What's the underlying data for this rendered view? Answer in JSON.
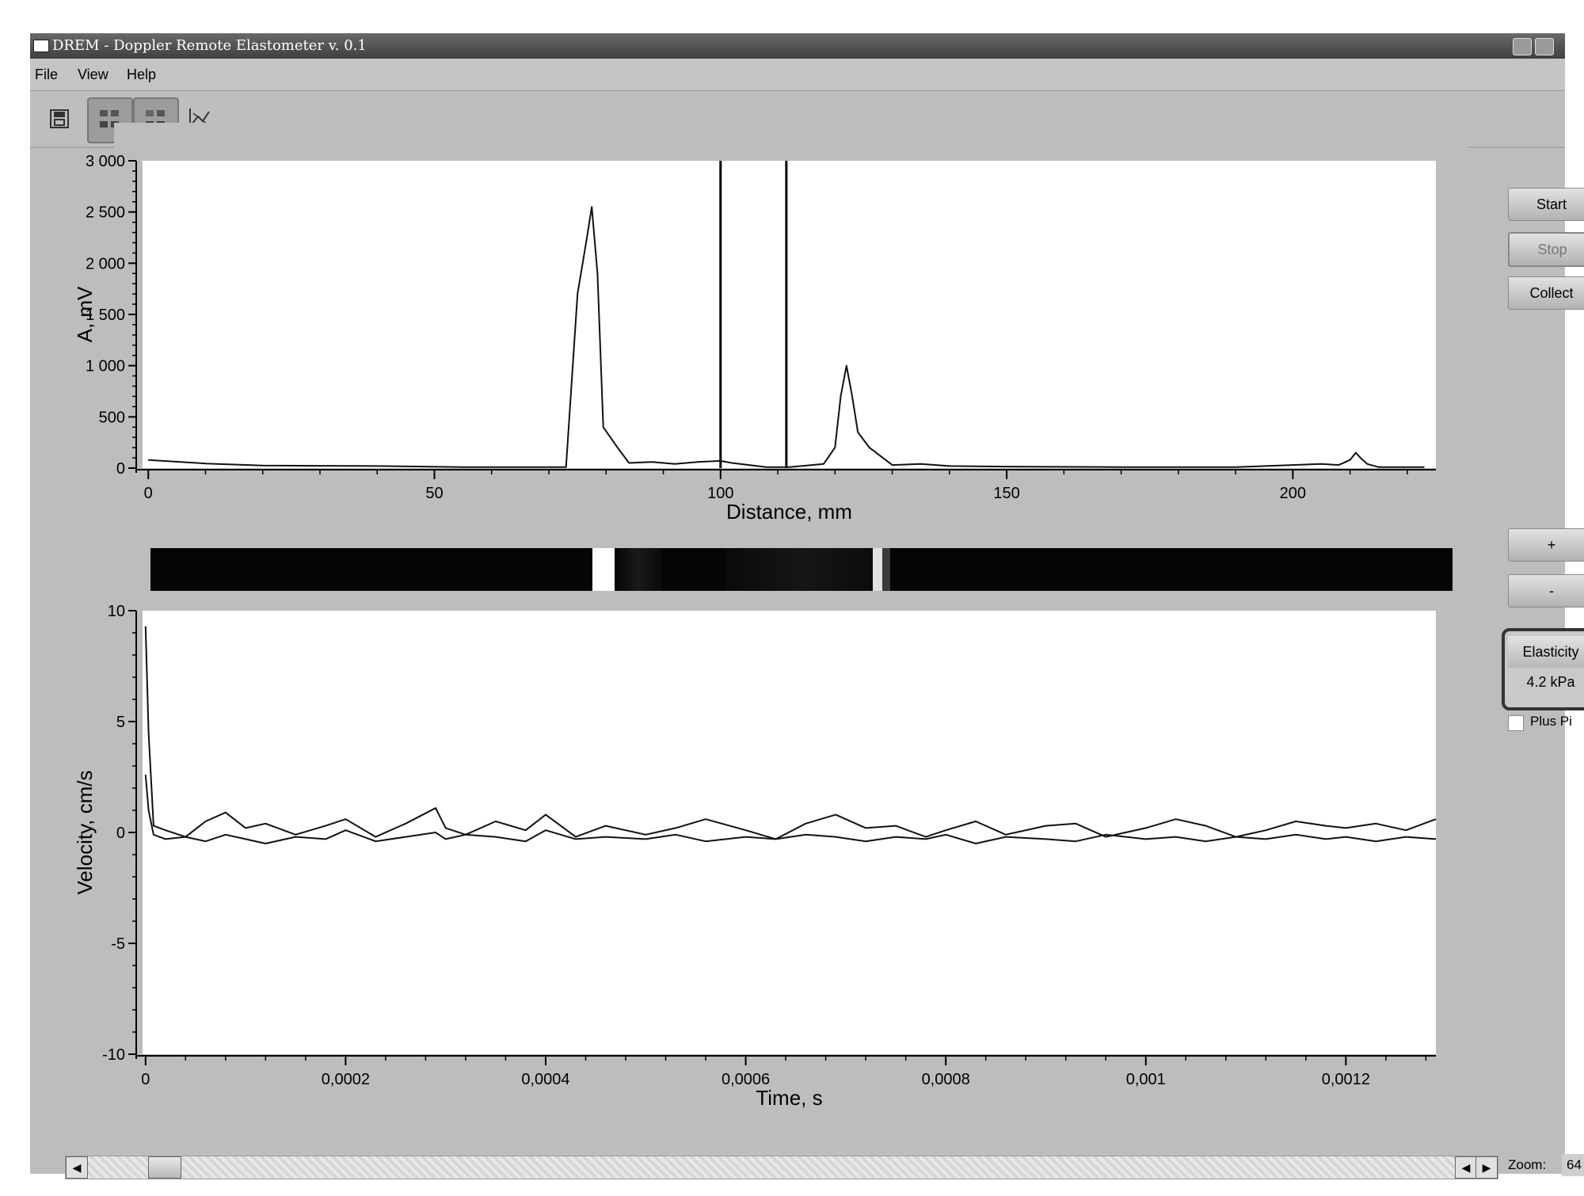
{
  "window": {
    "title": "DREM - Doppler Remote Elastometer v. 0.1"
  },
  "menu": [
    "File",
    "View",
    "Help"
  ],
  "toolbar": {
    "icons": [
      "save-icon",
      "grid-view-icon",
      "grid-view-alt-icon",
      "chart-icon"
    ]
  },
  "controls": {
    "start": "Start",
    "stop": "Stop",
    "collect": "Collect",
    "plus": "+",
    "minus": "-",
    "elasticity_label": "Elasticity",
    "elasticity_value": "4.2 kPa",
    "plus_pi": "Plus Pi",
    "zoom_label": "Zoom:",
    "zoom_value": "64"
  },
  "chart_data": [
    {
      "type": "line",
      "xlabel": "Distance, mm",
      "ylabel": "A, mV",
      "xlim": [
        -1,
        225
      ],
      "ylim": [
        0,
        3000
      ],
      "xticks": [
        0,
        50,
        100,
        150,
        200
      ],
      "xtick_labels": [
        "0",
        "50",
        "100",
        "150",
        "200"
      ],
      "yticks": [
        0,
        500,
        1000,
        1500,
        2000,
        2500,
        3000
      ],
      "ytick_labels": [
        "0",
        "500",
        "1 000",
        "1 500",
        "2 000",
        "2 500",
        "3 000"
      ],
      "markers_x": [
        100,
        111.5
      ],
      "series": [
        {
          "x": [
            0,
            10,
            20,
            40,
            55,
            73,
            75,
            76.5,
            77.5,
            78.5,
            79.5,
            82,
            84,
            88,
            92,
            96,
            100,
            102,
            105,
            108,
            112,
            118,
            120,
            121,
            122,
            123,
            124,
            126,
            130,
            135,
            140,
            150,
            170,
            190,
            205,
            208,
            210,
            211,
            212,
            213,
            215,
            218,
            223
          ],
          "y": [
            80,
            45,
            25,
            20,
            10,
            10,
            1700,
            2200,
            2550,
            1900,
            400,
            200,
            50,
            60,
            40,
            60,
            70,
            50,
            30,
            10,
            10,
            40,
            200,
            700,
            1000,
            700,
            350,
            200,
            30,
            40,
            20,
            15,
            10,
            10,
            40,
            30,
            80,
            150,
            90,
            40,
            10,
            10,
            10
          ]
        }
      ]
    },
    {
      "type": "line",
      "xlabel": "Time, s",
      "ylabel": "Velocity, cm/s",
      "xlim": [
        -3e-06,
        0.00129
      ],
      "ylim": [
        -10,
        10
      ],
      "xticks": [
        0,
        0.0002,
        0.0004,
        0.0006,
        0.0008,
        0.001,
        0.0012
      ],
      "xtick_labels": [
        "0",
        "0,0002",
        "0,0004",
        "0,0006",
        "0,0008",
        "0,001",
        "0,0012"
      ],
      "yticks": [
        -10,
        -5,
        0,
        5,
        10
      ],
      "ytick_labels": [
        "-10",
        "-5",
        "0",
        "5",
        "10"
      ],
      "series": [
        {
          "x": [
            0,
            3e-06,
            8e-06,
            2e-05,
            4e-05,
            6e-05,
            8e-05,
            0.0001,
            0.00012,
            0.00015,
            0.00018,
            0.0002,
            0.00023,
            0.00026,
            0.00029,
            0.0003,
            0.00032,
            0.00035,
            0.00038,
            0.0004,
            0.00043,
            0.00046,
            0.0005,
            0.00053,
            0.00056,
            0.0006,
            0.00063,
            0.00066,
            0.00069,
            0.00072,
            0.00075,
            0.00078,
            0.0008,
            0.00083,
            0.00086,
            0.0009,
            0.00093,
            0.00096,
            0.001,
            0.00103,
            0.00106,
            0.00109,
            0.00112,
            0.00115,
            0.00118,
            0.0012,
            0.00123,
            0.00126,
            0.00129
          ],
          "y": [
            9.3,
            4.5,
            0.3,
            0.1,
            -0.2,
            0.5,
            0.9,
            0.2,
            0.4,
            -0.1,
            0.3,
            0.6,
            -0.2,
            0.4,
            1.1,
            0.2,
            -0.1,
            0.5,
            0.1,
            0.8,
            -0.2,
            0.3,
            -0.1,
            0.2,
            0.6,
            0.1,
            -0.3,
            0.4,
            0.8,
            0.2,
            0.3,
            -0.2,
            0.1,
            0.5,
            -0.1,
            0.3,
            0.4,
            -0.2,
            0.2,
            0.6,
            0.3,
            -0.2,
            0.1,
            0.5,
            0.3,
            0.2,
            0.4,
            0.1,
            0.6
          ]
        },
        {
          "x": [
            0,
            3e-06,
            8e-06,
            2e-05,
            4e-05,
            6e-05,
            8e-05,
            0.0001,
            0.00012,
            0.00015,
            0.00018,
            0.0002,
            0.00023,
            0.00026,
            0.00029,
            0.0003,
            0.00032,
            0.00035,
            0.00038,
            0.0004,
            0.00043,
            0.00046,
            0.0005,
            0.00053,
            0.00056,
            0.0006,
            0.00063,
            0.00066,
            0.00069,
            0.00072,
            0.00075,
            0.00078,
            0.0008,
            0.00083,
            0.00086,
            0.0009,
            0.00093,
            0.00096,
            0.001,
            0.00103,
            0.00106,
            0.00109,
            0.00112,
            0.00115,
            0.00118,
            0.0012,
            0.00123,
            0.00126,
            0.00129
          ],
          "y": [
            2.6,
            1.0,
            -0.1,
            -0.3,
            -0.2,
            -0.4,
            -0.1,
            -0.3,
            -0.5,
            -0.2,
            -0.3,
            0.1,
            -0.4,
            -0.2,
            0.0,
            -0.3,
            -0.1,
            -0.2,
            -0.4,
            0.1,
            -0.3,
            -0.2,
            -0.3,
            -0.1,
            -0.4,
            -0.2,
            -0.3,
            -0.1,
            -0.2,
            -0.4,
            -0.2,
            -0.3,
            -0.1,
            -0.5,
            -0.2,
            -0.3,
            -0.4,
            -0.1,
            -0.3,
            -0.2,
            -0.4,
            -0.2,
            -0.3,
            -0.1,
            -0.3,
            -0.2,
            -0.4,
            -0.2,
            -0.3
          ]
        }
      ]
    }
  ]
}
